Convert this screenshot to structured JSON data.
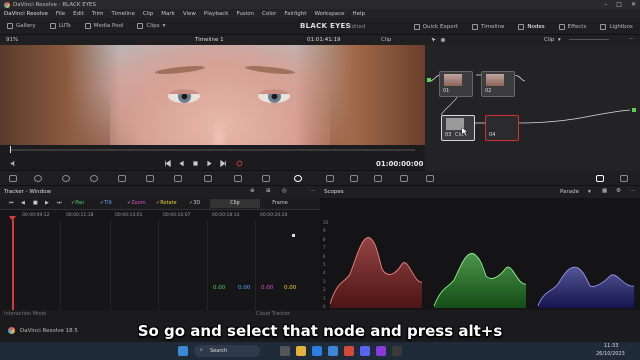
{
  "window": {
    "title": "DaVinci Resolve - BLACK EYES",
    "controls": [
      "–",
      "□",
      "✕"
    ]
  },
  "menu": {
    "app": "DaVinci Resolve",
    "items": [
      "File",
      "Edit",
      "Trim",
      "Timeline",
      "Clip",
      "Mark",
      "View",
      "Playback",
      "Fusion",
      "Color",
      "Fairlight",
      "Workspace",
      "Help"
    ]
  },
  "pagebar": {
    "left": [
      {
        "label": "Gallery",
        "icon": "gallery-icon"
      },
      {
        "label": "LUTs",
        "icon": "luts-icon"
      },
      {
        "label": "Media Pool",
        "icon": "media-pool-icon"
      },
      {
        "label": "Clips",
        "icon": "clips-icon"
      }
    ],
    "project_title": "BLACK EYES",
    "project_status": "Edited",
    "right": [
      {
        "label": "Quick Export",
        "icon": "export-icon"
      },
      {
        "label": "Timeline",
        "icon": "timeline-icon"
      },
      {
        "label": "Nodes",
        "icon": "nodes-icon"
      },
      {
        "label": "Effects",
        "icon": "effects-icon"
      },
      {
        "label": "Lightbox",
        "icon": "lightbox-icon"
      }
    ]
  },
  "viewer": {
    "zoom": "91%",
    "timeline_name": "Timeline 1",
    "timecode": "01:01:41:19",
    "clip_label": "Clip",
    "bottom_timecode": "01:00:00:00"
  },
  "nodes": {
    "mode": "Clip",
    "items": [
      {
        "num": "01",
        "label": ""
      },
      {
        "num": "02",
        "label": ""
      },
      {
        "num": "03",
        "label": "Clo..."
      },
      {
        "num": "04",
        "label": ""
      }
    ]
  },
  "tracker": {
    "title": "Tracker - Window",
    "checks": [
      {
        "label": "Pan",
        "color": "#4fd06a"
      },
      {
        "label": "Tilt",
        "color": "#5aa8ff"
      },
      {
        "label": "Zoom",
        "color": "#e34fd0"
      },
      {
        "label": "Rotate",
        "color": "#f0d030"
      },
      {
        "label": "3D",
        "color": "#9a9a9a"
      }
    ],
    "modes": [
      "Clip",
      "Frame"
    ],
    "ticks": [
      "00:00:09:12",
      "00:00:11:18",
      "00:00:14:01",
      "00:00:16:07",
      "00:00:18:14",
      "00:00:20:20"
    ],
    "values": [
      {
        "v": "0.00",
        "color": "#4fd06a"
      },
      {
        "v": "0.00",
        "color": "#5aa8ff"
      },
      {
        "v": "0.00",
        "color": "#e34fd0"
      },
      {
        "v": "0.00",
        "color": "#f0d030"
      }
    ],
    "interaction_mode": "Interaction Mode",
    "cloud_tracker": "Cloud Tracker"
  },
  "scopes": {
    "title": "Scopes",
    "type": "Parade",
    "axis": [
      "10",
      "9",
      "8",
      "7",
      "6",
      "5",
      "4",
      "3",
      "2",
      "1",
      "0"
    ]
  },
  "appbar": {
    "name": "DaVinci Resolve 18.5"
  },
  "subtitle": "So go and select that node and press alt+s",
  "taskbar": {
    "search": "Search",
    "time": "11:33",
    "date": "26/10/2023"
  }
}
